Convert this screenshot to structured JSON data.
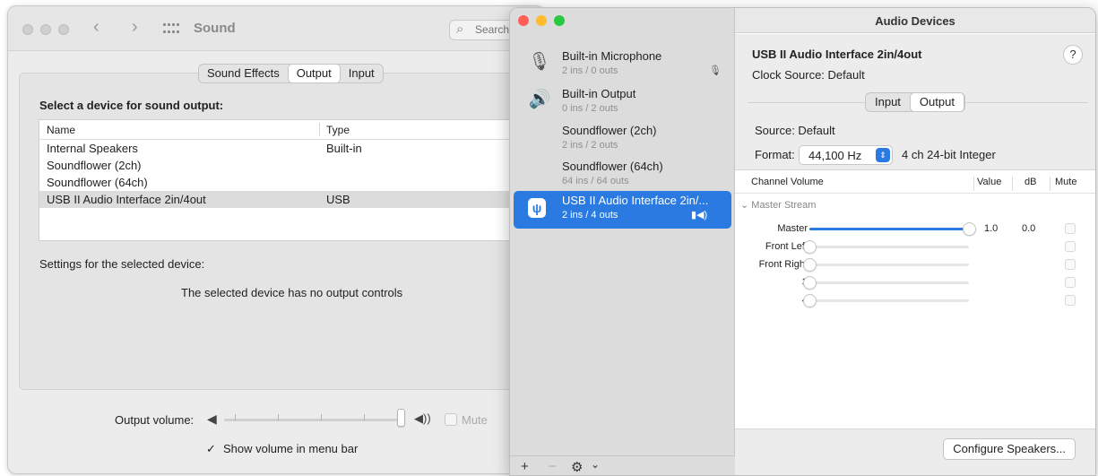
{
  "sound_prefs": {
    "window_title": "Sound",
    "search_placeholder": "Search",
    "tabs": [
      {
        "label": "Sound Effects",
        "selected": false
      },
      {
        "label": "Output",
        "selected": true
      },
      {
        "label": "Input",
        "selected": false
      }
    ],
    "select_heading": "Select a device for sound output:",
    "table_headers": {
      "name": "Name",
      "type": "Type"
    },
    "devices": [
      {
        "name": "Internal Speakers",
        "type": "Built-in"
      },
      {
        "name": "Soundflower (2ch)",
        "type": ""
      },
      {
        "name": "Soundflower (64ch)",
        "type": ""
      },
      {
        "name": "USB II Audio Interface 2in/4out",
        "type": "USB"
      }
    ],
    "selected_device_index": 3,
    "settings_label": "Settings for the selected device:",
    "no_controls_text": "The selected device has no output controls",
    "output_volume_label": "Output volume:",
    "mute_label": "Mute",
    "show_in_menu_label": "Show volume in menu bar",
    "show_in_menu_checked": true
  },
  "audio_devices": {
    "window_title": "Audio Devices",
    "devices": [
      {
        "name": "Built-in Microphone",
        "io": "2 ins / 0 outs",
        "icon": "microphone-icon"
      },
      {
        "name": "Built-in Output",
        "io": "0 ins / 2 outs",
        "icon": "speaker-icon"
      },
      {
        "name": "Soundflower (2ch)",
        "io": "2 ins / 2 outs",
        "icon": ""
      },
      {
        "name": "Soundflower (64ch)",
        "io": "64 ins / 64 outs",
        "icon": ""
      },
      {
        "name": "USB II Audio Interface 2in/...",
        "io": "2 ins / 4 outs",
        "icon": "usb-icon"
      }
    ],
    "selected_index": 4,
    "sidebar_buttons": {
      "add": "+",
      "remove": "−",
      "gear": "⚙",
      "menu": "⌄"
    },
    "detail": {
      "device_name": "USB II Audio Interface 2in/4out",
      "help_label": "?",
      "clock_source": "Clock Source:  Default",
      "tabs": [
        {
          "label": "Input",
          "selected": false
        },
        {
          "label": "Output",
          "selected": true
        }
      ],
      "source": "Source:  Default",
      "format_label": "Format:",
      "format_value": "44,100 Hz",
      "format_desc": "4 ch 24-bit Integer",
      "table_headers": {
        "channel": "Channel Volume",
        "value": "Value",
        "db": "dB",
        "mute": "Mute"
      },
      "stream_label": "Master Stream",
      "channels": [
        {
          "name": "Master",
          "level": 1.0,
          "value": "1.0",
          "db": "0.0"
        },
        {
          "name": "Front Left",
          "level": 0.0,
          "value": "",
          "db": ""
        },
        {
          "name": "Front Right",
          "level": 0.0,
          "value": "",
          "db": ""
        },
        {
          "name": "3",
          "level": 0.0,
          "value": "",
          "db": ""
        },
        {
          "name": "4",
          "level": 0.0,
          "value": "",
          "db": ""
        }
      ],
      "configure_button": "Configure Speakers..."
    }
  },
  "colors": {
    "accent": "#2a7ae2",
    "traffic_red": "#ff5f57",
    "traffic_yellow": "#febc2e",
    "traffic_green": "#28c840"
  },
  "output_volume_level": 1.0
}
